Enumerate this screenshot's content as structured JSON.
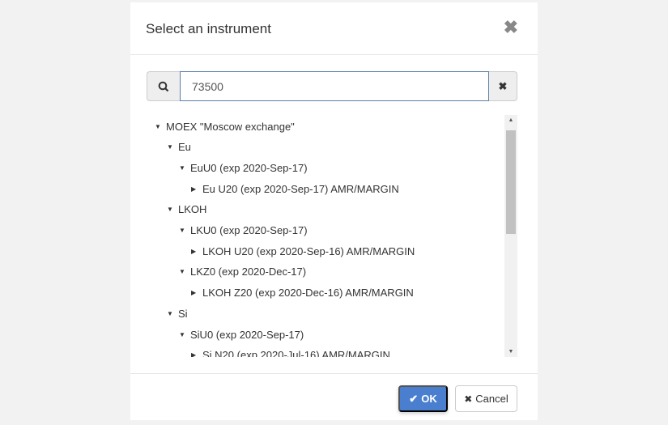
{
  "dialog": {
    "title": "Select an instrument"
  },
  "search": {
    "value": "73500"
  },
  "tree": [
    {
      "label": "MOEX \"Moscow exchange\"",
      "level": 0,
      "expanded": true
    },
    {
      "label": "Eu",
      "level": 1,
      "expanded": true
    },
    {
      "label": "EuU0 (exp 2020-Sep-17)",
      "level": 2,
      "expanded": true
    },
    {
      "label": "Eu U20 (exp 2020-Sep-17) AMR/MARGIN",
      "level": 3,
      "expanded": false
    },
    {
      "label": "LKOH",
      "level": 1,
      "expanded": true
    },
    {
      "label": "LKU0 (exp 2020-Sep-17)",
      "level": 2,
      "expanded": true
    },
    {
      "label": "LKOH U20 (exp 2020-Sep-16) AMR/MARGIN",
      "level": 3,
      "expanded": false
    },
    {
      "label": "LKZ0 (exp 2020-Dec-17)",
      "level": 2,
      "expanded": true
    },
    {
      "label": "LKOH Z20 (exp 2020-Dec-16) AMR/MARGIN",
      "level": 3,
      "expanded": false
    },
    {
      "label": "Si",
      "level": 1,
      "expanded": true
    },
    {
      "label": "SiU0 (exp 2020-Sep-17)",
      "level": 2,
      "expanded": true
    },
    {
      "label": "Si N20 (exp 2020-Jul-16) AMR/MARGIN",
      "level": 3,
      "expanded": false
    }
  ],
  "footer": {
    "ok": "OK",
    "cancel": "Cancel"
  },
  "colors": {
    "primary": "#4a7fcf"
  }
}
